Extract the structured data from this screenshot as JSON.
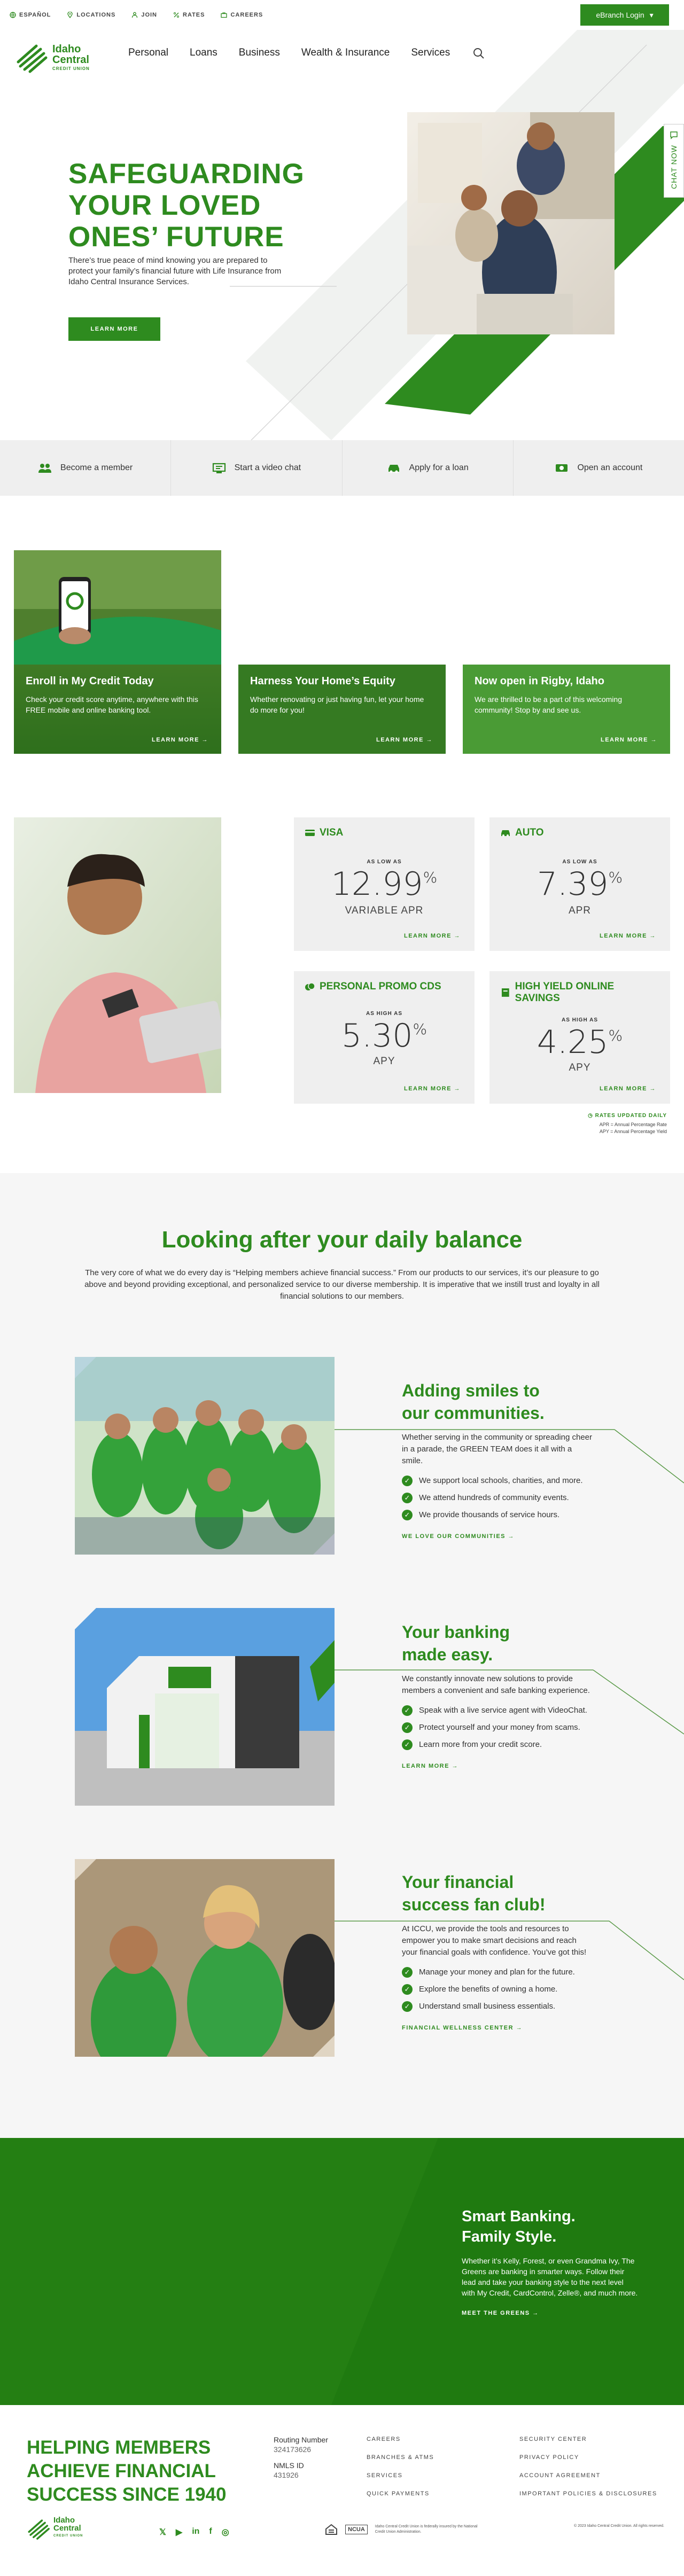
{
  "utility": {
    "links": [
      "ESPAÑOL",
      "LOCATIONS",
      "JOIN",
      "RATES",
      "CAREERS"
    ],
    "ebranch": "eBranch Login"
  },
  "brand": {
    "line1": "Idaho",
    "line2": "Central",
    "line3": "CREDIT UNION",
    "color": "#2e8b1f"
  },
  "nav": [
    "Personal",
    "Loans",
    "Business",
    "Wealth & Insurance",
    "Services"
  ],
  "chat": "CHAT NOW",
  "hero": {
    "title": "SAFEGUARDING YOUR LOVED ONES’ FUTURE",
    "text": "There’s true peace of mind knowing you are prepared to protect your family’s financial future with Life Insurance from Idaho Central Insurance Services.",
    "button": "LEARN MORE"
  },
  "quick": [
    "Become a member",
    "Start a video chat",
    "Apply for a loan",
    "Open an account"
  ],
  "promos": [
    {
      "title": "Enroll in My Credit Today",
      "text": "Check your credit score anytime, anywhere with this FREE mobile and online banking tool.",
      "link": "LEARN MORE"
    },
    {
      "title": "Harness Your Home’s Equity",
      "text": "Whether renovating or just having fun, let your home do more for you!",
      "link": "LEARN MORE"
    },
    {
      "title": "Now open in Rigby, Idaho",
      "text": "We are thrilled to be a part of this welcoming community! Stop by and see us.",
      "link": "LEARN MORE"
    }
  ],
  "rates": [
    {
      "name": "VISA",
      "label": "AS LOW AS",
      "value": "12.99",
      "unit": "VARIABLE APR",
      "link": "LEARN MORE"
    },
    {
      "name": "AUTO",
      "label": "AS LOW AS",
      "value": "7.39",
      "unit": "APR",
      "link": "LEARN MORE"
    },
    {
      "name": "PERSONAL PROMO CDS",
      "label": "AS HIGH AS",
      "value": "5.30",
      "unit": "APY",
      "link": "LEARN MORE"
    },
    {
      "name": "HIGH YIELD ONLINE SAVINGS",
      "label": "AS HIGH AS",
      "value": "4.25",
      "unit": "APY",
      "link": "LEARN MORE"
    }
  ],
  "rates_note": {
    "title": "RATES UPDATED DAILY",
    "l1": "APR = Annual Percentage Rate",
    "l2": "APY = Annual Percentage Yield"
  },
  "balance": {
    "title": "Looking after your daily balance",
    "text": "The very core of what we do every day is “Helping members achieve financial success.” From our products to our services, it’s our pleasure to go above and beyond providing exceptional, and personalized service to our diverse membership. It is imperative that we instill trust and loyalty in all financial solutions to our members."
  },
  "features": [
    {
      "t1": "Adding smiles to",
      "t2": "our communities.",
      "text": "Whether serving in the community or spreading cheer in a parade, the GREEN TEAM does it all with a smile.",
      "items": [
        "We support local schools, charities, and more.",
        "We attend hundreds of community events.",
        "We provide thousands of service hours."
      ],
      "link": "WE LOVE OUR COMMUNITIES"
    },
    {
      "t1": "Your banking",
      "t2": "made easy.",
      "text": "We constantly innovate new solutions to provide members a convenient and safe banking experience.",
      "items": [
        "Speak with a live service agent with VideoChat.",
        "Protect yourself and your money from scams.",
        "Learn more from your credit score."
      ],
      "link": "LEARN MORE"
    },
    {
      "t1": "Your financial",
      "t2": "success fan club!",
      "text": "At ICCU, we provide the tools and resources to empower you to make smart decisions and reach your financial goals with confidence. You’ve got this!",
      "items": [
        "Manage your money and plan for the future.",
        "Explore the benefits of owning a home.",
        "Understand small business essentials."
      ],
      "link": "FINANCIAL WELLNESS CENTER"
    }
  ],
  "smart": {
    "t1": "Smart Banking.",
    "t2": "Family Style.",
    "text": "Whether it’s Kelly, Forest, or even Grandma Ivy, The Greens are banking in smarter ways. Follow their lead and take your banking style to the next level with My Credit, CardControl, Zelle®, and much more.",
    "link": "MEET THE GREENS"
  },
  "footer": {
    "title": "HELPING MEMBERS ACHIEVE FINANCIAL SUCCESS SINCE 1940",
    "routing_label": "Routing Number",
    "routing": "324173626",
    "nmls_label": "NMLS ID",
    "nmls": "431926",
    "col1": [
      "CAREERS",
      "BRANCHES & ATMS",
      "SERVICES",
      "QUICK PAYMENTS"
    ],
    "col2": [
      "SECURITY CENTER",
      "PRIVACY POLICY",
      "ACCOUNT AGREEMENT",
      "IMPORTANT POLICIES & DISCLOSURES"
    ],
    "ncua": "NCUA",
    "ncua_text": "Idaho Central Credit Union is federally insured by the National Credit Union Administration.",
    "copyright": "© 2023 Idaho Central Credit Union. All rights reserved."
  }
}
